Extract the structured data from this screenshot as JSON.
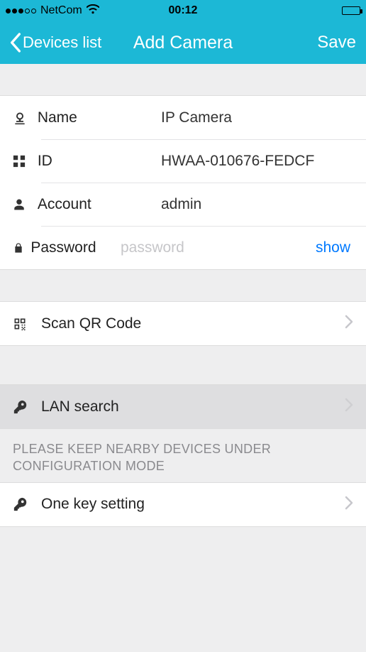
{
  "status": {
    "carrier": "NetCom",
    "time": "00:12"
  },
  "nav": {
    "back_label": "Devices list",
    "title": "Add Camera",
    "save_label": "Save"
  },
  "form": {
    "name": {
      "label": "Name",
      "value": "IP Camera"
    },
    "id": {
      "label": "ID",
      "value": "HWAA-010676-FEDCF"
    },
    "account": {
      "label": "Account",
      "value": "admin"
    },
    "password": {
      "label": "Password",
      "placeholder": "password",
      "show_label": "show"
    }
  },
  "actions": {
    "scan_qr": {
      "label": "Scan QR Code"
    },
    "lan_search": {
      "label": "LAN search"
    },
    "one_key": {
      "label": "One key setting"
    }
  },
  "note": "PLEASE KEEP NEARBY DEVICES UNDER CONFIGURATION MODE"
}
